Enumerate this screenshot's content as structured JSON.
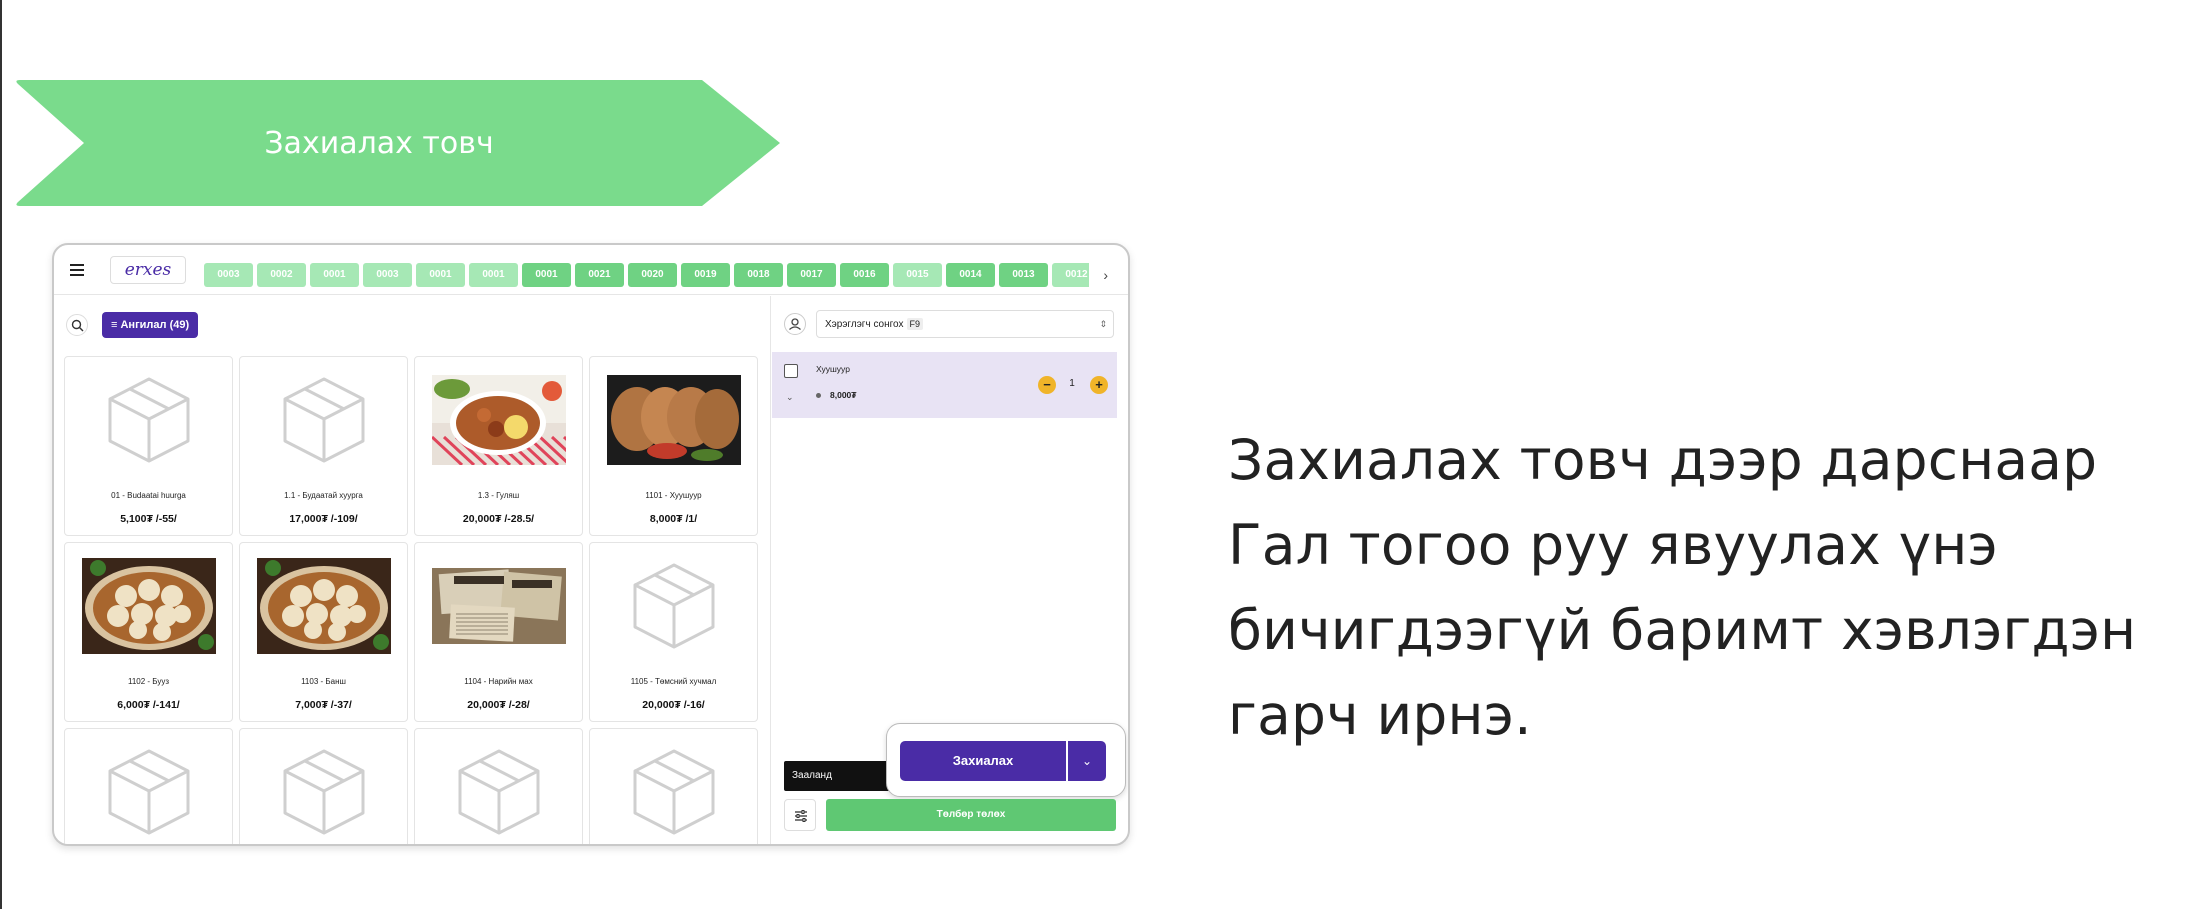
{
  "banner": {
    "label": "Захиалах товч",
    "color": "#7adb8c"
  },
  "description": "Захиалах товч дээр дарснаар Гал тогоо руу явуулах үнэ бичигдээгүй баримт хэвлэгдэн гарч ирнэ.",
  "app": {
    "logo": "erxes",
    "order_chips": [
      {
        "label": "0003",
        "state": "light"
      },
      {
        "label": "0002",
        "state": "light"
      },
      {
        "label": "0001",
        "state": "light"
      },
      {
        "label": "0003",
        "state": "light"
      },
      {
        "label": "0001",
        "state": "light"
      },
      {
        "label": "0001",
        "state": "light"
      },
      {
        "label": "0001",
        "state": "dark"
      },
      {
        "label": "0021",
        "state": "dark"
      },
      {
        "label": "0020",
        "state": "dark"
      },
      {
        "label": "0019",
        "state": "dark"
      },
      {
        "label": "0018",
        "state": "dark"
      },
      {
        "label": "0017",
        "state": "dark"
      },
      {
        "label": "0016",
        "state": "dark"
      },
      {
        "label": "0015",
        "state": "light"
      },
      {
        "label": "0014",
        "state": "dark"
      },
      {
        "label": "0013",
        "state": "dark"
      },
      {
        "label": "0012",
        "state": "light"
      }
    ],
    "category_button": "Ангилал (49)",
    "products": [
      {
        "name": "01 - Budaatai huurga",
        "price": "5,100₮ /-55/",
        "image": "box-icon"
      },
      {
        "name": "1.1 - Будаатай хуурга",
        "price": "17,000₮ /-109/",
        "image": "box-icon"
      },
      {
        "name": "1.3 - Гуляш",
        "price": "20,000₮ /-28.5/",
        "image": "goulash-photo"
      },
      {
        "name": "1101 - Хуушуур",
        "price": "8,000₮ /1/",
        "image": "khuushuur-photo"
      },
      {
        "name": "1102 - Бууз",
        "price": "6,000₮ /-141/",
        "image": "buuz-photo"
      },
      {
        "name": "1103 - Банш",
        "price": "7,000₮ /-37/",
        "image": "bansh-photo"
      },
      {
        "name": "1104 - Нарийн мах",
        "price": "20,000₮ /-28/",
        "image": "newspaper-photo"
      },
      {
        "name": "1105 - Төмсний хучмал",
        "price": "20,000₮ /-16/",
        "image": "box-icon"
      },
      {
        "name": "",
        "price": "",
        "image": "box-icon"
      },
      {
        "name": "",
        "price": "",
        "image": "box-icon"
      },
      {
        "name": "",
        "price": "",
        "image": "box-icon"
      },
      {
        "name": "",
        "price": "",
        "image": "box-icon"
      }
    ],
    "customer": {
      "placeholder": "Хэрэглэгч сонгох",
      "shortcut": "F9"
    },
    "cart": [
      {
        "name": "Хуушуур",
        "price": "8,000₮",
        "qty": "1"
      }
    ],
    "hall_label": "Зааланд",
    "order_button": "Захиалах",
    "pay_button": "Төлбөр төлөх",
    "colors": {
      "primary": "#4a2ca6",
      "green": "#5fc873",
      "chip_dark": "#6fd283",
      "chip_light": "#a6e8b5",
      "qty": "#f0b429",
      "cart_bg": "#e8e3f4"
    }
  }
}
